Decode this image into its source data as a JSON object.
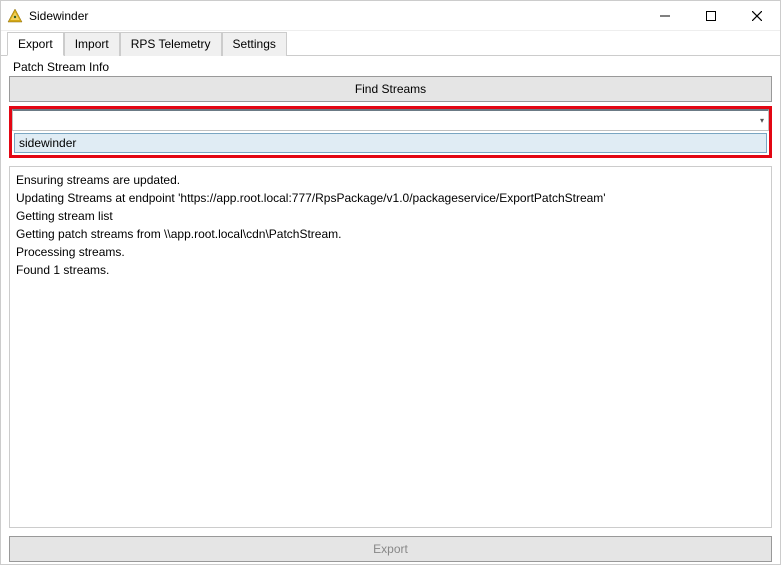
{
  "window": {
    "title": "Sidewinder"
  },
  "tabs": {
    "t0": "Export",
    "t1": "Import",
    "t2": "RPS Telemetry",
    "t3": "Settings"
  },
  "group": {
    "label": "Patch Stream Info",
    "findButton": "Find Streams",
    "selectedStream": "sidewinder"
  },
  "log": {
    "l0": "Ensuring streams are updated.",
    "l1": "Updating Streams at endpoint 'https://app.root.local:777/RpsPackage/v1.0/packageservice/ExportPatchStream'",
    "l2": "Getting stream list",
    "l3": "Getting patch streams from \\\\app.root.local\\cdn\\PatchStream.",
    "l4": "Processing streams.",
    "l5": "Found 1 streams."
  },
  "footer": {
    "exportButton": "Export"
  }
}
